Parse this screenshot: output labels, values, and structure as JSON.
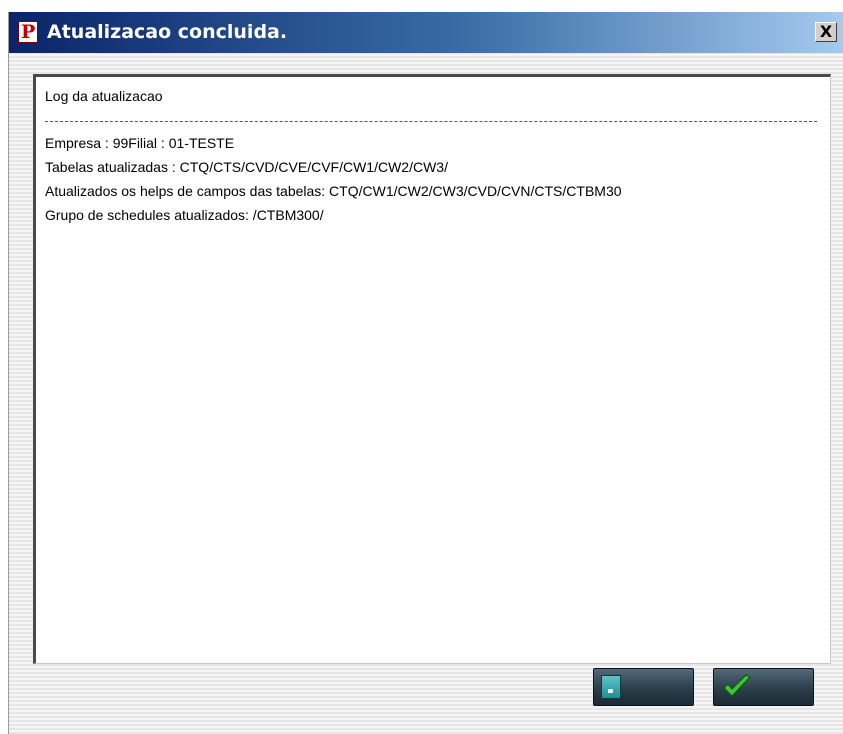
{
  "window": {
    "title": "Atualizacao concluida.",
    "app_icon_letter": "P",
    "close_label": "X"
  },
  "log": {
    "header": "Log da atualizacao",
    "lines": [
      "Empresa : 99Filial : 01-TESTE",
      "Tabelas atualizadas : CTQ/CTS/CVD/CVE/CVF/CW1/CW2/CW3/",
      "Atualizados os helps de campos das tabelas: CTQ/CW1/CW2/CW3/CVD/CVN/CTS/CTBM30",
      "Grupo de schedules atualizados: /CTBM300/"
    ]
  },
  "buttons": {
    "left": {
      "icon": "document-icon"
    },
    "right": {
      "icon": "checkmark-icon"
    }
  },
  "colors": {
    "title_gradient_start": "#0a246a",
    "title_gradient_end": "#a6caf0",
    "button_face": "#2c3e4a",
    "check_green": "#3cc43c",
    "doc_teal": "#1e8e94"
  }
}
